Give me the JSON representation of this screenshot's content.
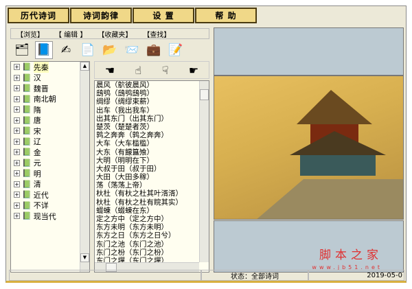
{
  "menu": [
    "历代诗词",
    "诗词韵律",
    "设 置",
    "帮 助"
  ],
  "tabs": [
    "【浏览】",
    "【 编辑 】",
    "【收藏夹】",
    "【查找】"
  ],
  "toolbar": [
    "browse-icon",
    "book-icon",
    "write-icon",
    "copy-icon",
    "folder-icon",
    "open-folder-icon",
    "briefcase-icon",
    "edit-icon"
  ],
  "tree": [
    "先秦",
    "汉",
    "魏晋",
    "南北朝",
    "隋",
    "唐",
    "宋",
    "辽",
    "金",
    "元",
    "明",
    "清",
    "近代",
    "不详",
    "现当代"
  ],
  "nav_hands": [
    "hand-left-icon",
    "hand-up-icon",
    "hand-down-icon",
    "hand-right-icon"
  ],
  "poems": [
    "晨风（鴥彼晨风）",
    "鴟鸮（鴟鸮鴟鸮）",
    "绸缪（绸缪束薪）",
    "出车（我出我车）",
    "出其东门（出其东门）",
    "楚茨（楚楚者茨）",
    "鹑之奔奔（鹑之奔奔）",
    "大车（大车槛槛）",
    "大东（有饛簋飧）",
    "大明（明明在下）",
    "大叔于田（叔于田）",
    "大田（大田多稼）",
    "荡（荡荡上帝）",
    "杕杜（有杕之杜其叶湑湑）",
    "杕杜（有杕之杜有睆其实）",
    "蝃蝀（蝃蝀在东）",
    "定之方中（定之方中）",
    "东方未明（东方未明）",
    "东方之日（东方之日兮）",
    "东门之池（东门之池）",
    "东门之枌（东门之枌）",
    "东门之墠（东门之墠）"
  ],
  "watermark": {
    "title": "脚本之家",
    "url": "www.jb51.net"
  },
  "status": {
    "left": "",
    "state": "状态：全部诗词",
    "date": "2019-05-0"
  }
}
